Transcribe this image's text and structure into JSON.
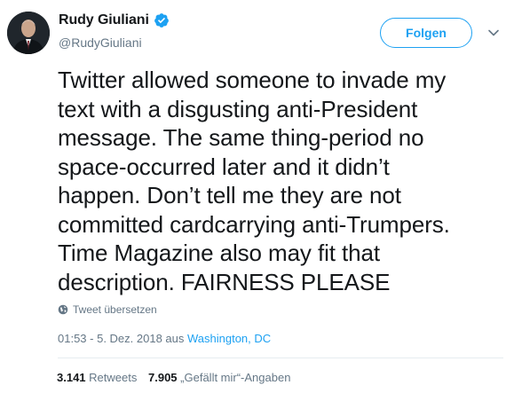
{
  "user": {
    "display_name": "Rudy Giuliani",
    "handle": "@RudyGiuliani",
    "verified": true
  },
  "actions": {
    "follow_label": "Folgen"
  },
  "tweet": {
    "lines": [
      "Twitter allowed someone to invade my",
      "text with a disgusting anti-President",
      "message. The same thing-period no",
      "space-occurred later and it didn’t",
      "happen. Don’t tell me they are not",
      "committed cardcarrying anti-Trumpers.",
      "Time Magazine also may fit that",
      "description. FAIRNESS PLEASE"
    ],
    "translate_label": "Tweet übersetzen",
    "timestamp": "01:53 - 5. Dez. 2018 aus ",
    "location": "Washington, DC"
  },
  "stats": {
    "retweets_count": "3.141",
    "retweets_label": "Retweets",
    "likes_count": "7.905",
    "likes_label": "„Gefällt mir“-Angaben"
  },
  "colors": {
    "accent": "#1da1f2",
    "secondary_text": "#657786",
    "primary_text": "#14171a",
    "divider": "#e6ecf0"
  },
  "icons": {
    "verified": "verified-badge-icon",
    "caret": "chevron-down-icon",
    "translate": "globe-icon"
  }
}
